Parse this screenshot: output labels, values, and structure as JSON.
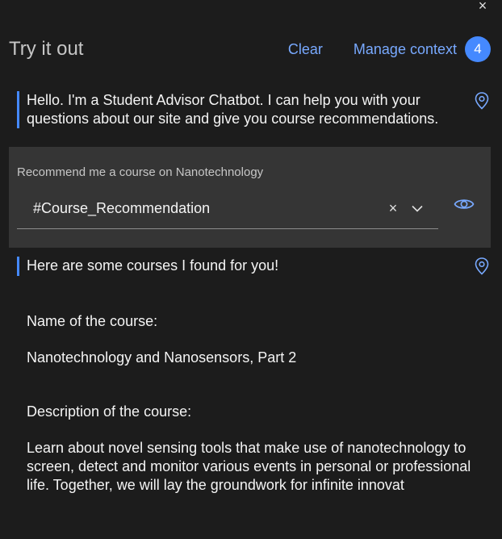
{
  "header": {
    "title": "Try it out",
    "clear_label": "Clear",
    "manage_context_label": "Manage context",
    "context_count": "4",
    "close_symbol": "×"
  },
  "messages": {
    "greeting": "Hello. I'm a Student Advisor Chatbot. I can help you with your questions about our site and give you course recommendations.",
    "user_query": "Recommend me a course on Nanotechnology",
    "intent_value": "#Course_Recommendation",
    "intent_clear_symbol": "×",
    "response_intro": "Here are some courses I found for you!",
    "response_lines": [
      "Name of the course:",
      "Nanotechnology and Nanosensors, Part 2",
      "Description of the course:",
      "Learn about novel sensing tools that make use of nanotechnology to screen, detect and monitor various events in personal or professional life. Together, we will lay the groundwork for infinite innovat"
    ]
  },
  "icons": {
    "bot_message_icon": "location-pin-icon",
    "intent_dropdown_icon": "chevron-down-icon",
    "preview_icon": "eye-icon",
    "close_icon": "close-icon"
  },
  "colors": {
    "background": "#1c1c1c",
    "user_box": "#353535",
    "accent": "#4589ff",
    "link": "#78a9ff"
  }
}
